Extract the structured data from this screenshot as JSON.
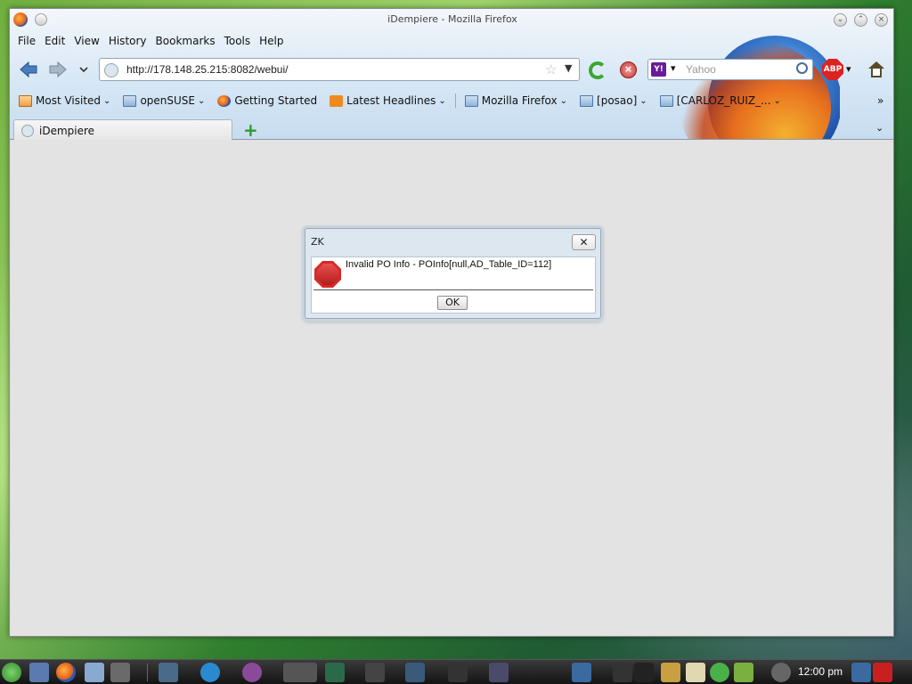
{
  "window": {
    "title": "iDempiere - Mozilla Firefox"
  },
  "menu": {
    "items": [
      "File",
      "Edit",
      "View",
      "History",
      "Bookmarks",
      "Tools",
      "Help"
    ]
  },
  "navbar": {
    "url": "http://178.148.25.215:8082/webui/",
    "search_placeholder": "Yahoo",
    "search_engine_icon": "yahoo-icon",
    "adblock_label": "ABP"
  },
  "bookmarks": {
    "items": [
      {
        "label": "Most Visited",
        "icon": "folder-icon",
        "dropdown": true
      },
      {
        "label": "openSUSE",
        "icon": "folder-icon",
        "dropdown": true
      },
      {
        "label": "Getting Started",
        "icon": "firefox-icon",
        "dropdown": false
      },
      {
        "label": "Latest Headlines",
        "icon": "rss-icon",
        "dropdown": true
      },
      {
        "label": "Mozilla Firefox",
        "icon": "folder-icon",
        "dropdown": true
      },
      {
        "label": "[posao]",
        "icon": "folder-icon",
        "dropdown": true
      },
      {
        "label": "[CARLOZ_RUIZ_...",
        "icon": "folder-icon",
        "dropdown": true
      }
    ],
    "overflow": "»"
  },
  "tabs": [
    {
      "label": "iDempiere",
      "active": true
    }
  ],
  "dialog": {
    "title": "ZK",
    "message": "Invalid PO Info - POInfo[null,AD_Table_ID=112]",
    "ok_label": "OK",
    "close_glyph": "✕",
    "icon": "stop-icon"
  },
  "taskbar": {
    "clock": "12:00 pm"
  }
}
